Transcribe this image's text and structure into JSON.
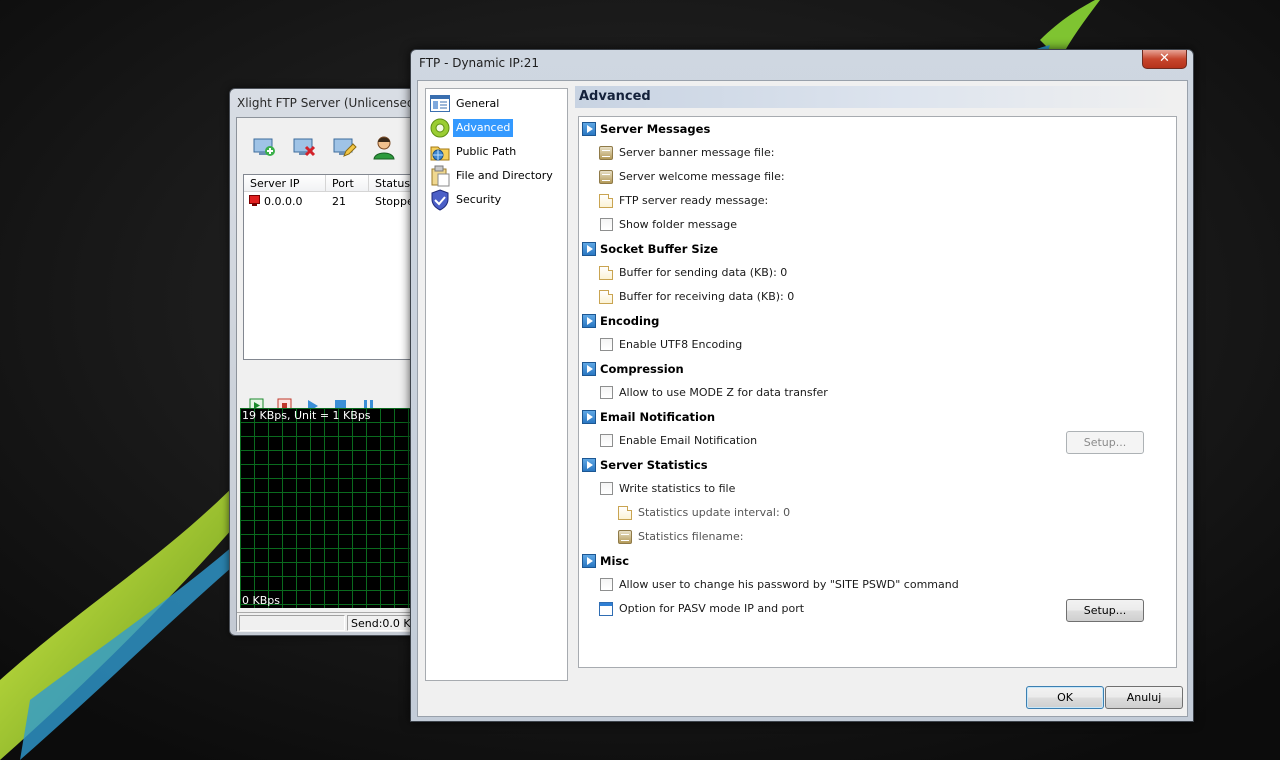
{
  "back_window": {
    "title": "Xlight FTP Server (Unlicensed)",
    "toolbar": [
      {
        "icon": "add-server-icon"
      },
      {
        "icon": "delete-server-icon"
      },
      {
        "icon": "edit-server-icon"
      },
      {
        "icon": "user-icon"
      }
    ],
    "list_headers": [
      "Server IP",
      "Port",
      "Status"
    ],
    "rows": [
      {
        "ip": "0.0.0.0",
        "port": "21",
        "status": "Stoppe"
      }
    ],
    "graph": {
      "top_label": "19 KBps, Unit = 1 KBps",
      "bottom_label": "0 KBps"
    },
    "status_bar": {
      "send": "Send:0.0 K"
    }
  },
  "dialog": {
    "title": "FTP - Dynamic IP:21",
    "close_label": "✕",
    "nav": [
      {
        "label": "General",
        "icon": "general-icon",
        "selected": false
      },
      {
        "label": "Advanced",
        "icon": "advanced-gear-icon",
        "selected": true
      },
      {
        "label": "Public Path",
        "icon": "public-path-icon",
        "selected": false
      },
      {
        "label": "File and Directory",
        "icon": "file-directory-icon",
        "selected": false
      },
      {
        "label": "Security",
        "icon": "security-shield-icon",
        "selected": false
      }
    ],
    "pane_title": "Advanced",
    "sections": [
      {
        "label": "Server Messages",
        "items": [
          {
            "type": "msg",
            "label": "Server banner message file:"
          },
          {
            "type": "msg",
            "label": "Server welcome message file:"
          },
          {
            "type": "doc",
            "label": "FTP server ready message:"
          },
          {
            "type": "check",
            "label": "Show folder message",
            "checked": false
          }
        ]
      },
      {
        "label": "Socket Buffer Size",
        "items": [
          {
            "type": "doc",
            "label": "Buffer for sending data (KB): 0"
          },
          {
            "type": "doc",
            "label": "Buffer for receiving data (KB): 0"
          }
        ]
      },
      {
        "label": "Encoding",
        "items": [
          {
            "type": "check",
            "label": "Enable UTF8 Encoding",
            "checked": false
          }
        ]
      },
      {
        "label": "Compression",
        "items": [
          {
            "type": "check",
            "label": "Allow to use MODE Z for data transfer",
            "checked": false
          }
        ]
      },
      {
        "label": "Email Notification",
        "items": [
          {
            "type": "check",
            "label": "Enable Email Notification",
            "checked": false,
            "button": "Setup...",
            "button_disabled": true
          }
        ]
      },
      {
        "label": "Server Statistics",
        "items": [
          {
            "type": "check",
            "label": "Write statistics to file",
            "checked": false
          },
          {
            "type": "doc",
            "label": "Statistics update interval: 0",
            "indent": true
          },
          {
            "type": "msg",
            "label": "Statistics filename:",
            "indent": true
          }
        ]
      },
      {
        "label": "Misc",
        "items": [
          {
            "type": "check",
            "label": "Allow user to change his password by \"SITE PSWD\" command",
            "checked": false
          },
          {
            "type": "win",
            "label": "Option for PASV mode IP and port",
            "button": "Setup...",
            "button_disabled": false
          }
        ]
      }
    ],
    "ok_label": "OK",
    "cancel_label": "Anuluj"
  }
}
